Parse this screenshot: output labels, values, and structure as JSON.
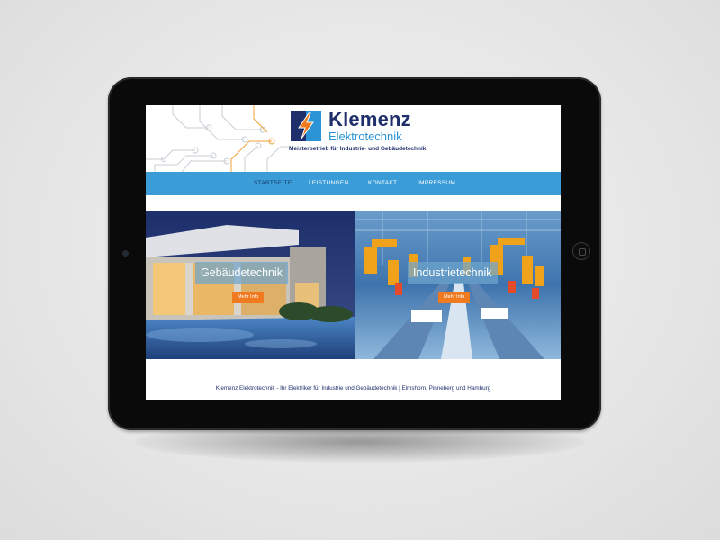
{
  "site": {
    "brand": {
      "name": "Klemenz",
      "subtitle": "Elektrotechnik",
      "tagline": "Meisterbetrieb für Industrie- und Gebäudetechnik",
      "logo_icon": "lightning-bolt-icon"
    },
    "nav": {
      "items": [
        {
          "label": "STARTSEITE",
          "active": true
        },
        {
          "label": "LEISTUNGEN",
          "active": false
        },
        {
          "label": "KONTAKT",
          "active": false
        },
        {
          "label": "IMPRESSUM",
          "active": false
        }
      ]
    },
    "hero": {
      "panels": [
        {
          "title": "Gebäudetechnik",
          "button": "Mehr Info",
          "image": "modern-house-photo"
        },
        {
          "title": "Industrietechnik",
          "button": "Mehr Info",
          "image": "robot-assembly-line-photo"
        }
      ]
    },
    "footer": {
      "text": "Klemenz Elektrotechnik - Ihr Elektriker für Industrie und Gebäudetechnik | Elmshorn, Pinneberg und Hamburg"
    }
  },
  "colors": {
    "nav_bg": "#3a9dd8",
    "brand_dark": "#1f2f6b",
    "brand_light": "#2a94d6",
    "accent_orange": "#f07a1f",
    "device_body": "#0a0a0a",
    "background": "#e8e8e8"
  },
  "device": {
    "type": "tablet",
    "home_button_icon": "home-button-icon",
    "camera_icon": "front-camera-icon"
  }
}
